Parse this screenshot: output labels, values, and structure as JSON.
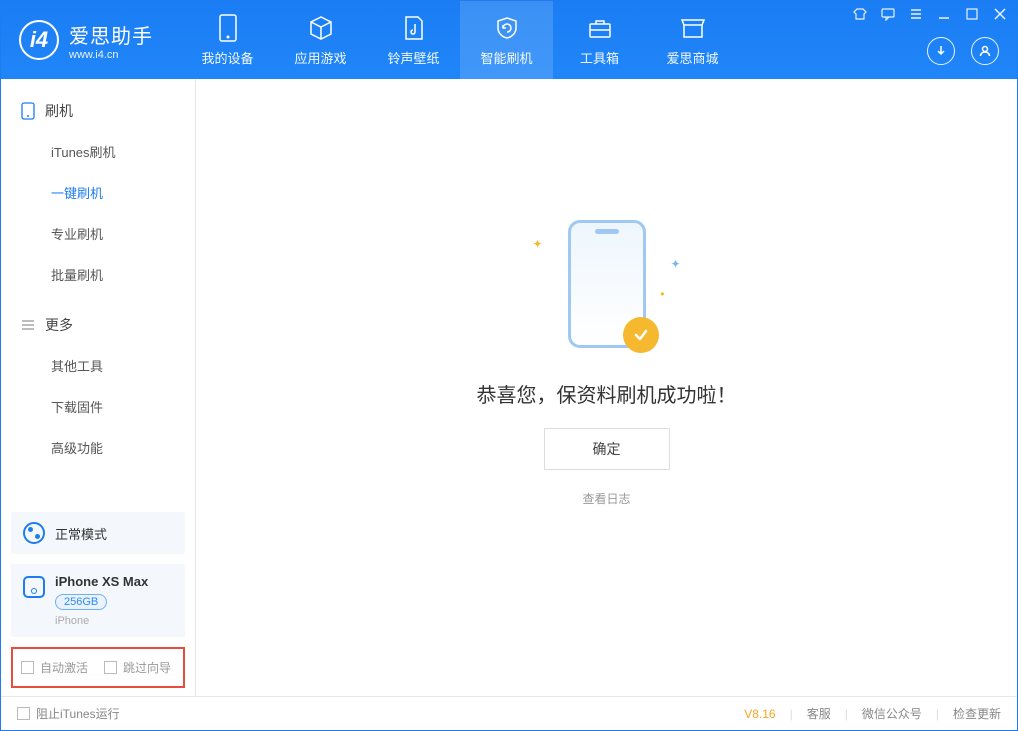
{
  "app": {
    "name_cn": "爱思助手",
    "name_en": "www.i4.cn"
  },
  "nav": {
    "tabs": [
      {
        "label": "我的设备"
      },
      {
        "label": "应用游戏"
      },
      {
        "label": "铃声壁纸"
      },
      {
        "label": "智能刷机"
      },
      {
        "label": "工具箱"
      },
      {
        "label": "爱思商城"
      }
    ],
    "active_index": 3
  },
  "sidebar": {
    "section1_title": "刷机",
    "section1_items": [
      {
        "label": "iTunes刷机"
      },
      {
        "label": "一键刷机"
      },
      {
        "label": "专业刷机"
      },
      {
        "label": "批量刷机"
      }
    ],
    "section1_active_index": 1,
    "section2_title": "更多",
    "section2_items": [
      {
        "label": "其他工具"
      },
      {
        "label": "下载固件"
      },
      {
        "label": "高级功能"
      }
    ]
  },
  "status": {
    "mode_label": "正常模式"
  },
  "device": {
    "name": "iPhone XS Max",
    "capacity": "256GB",
    "type": "iPhone"
  },
  "options": {
    "auto_activate": "自动激活",
    "skip_guide": "跳过向导"
  },
  "main": {
    "success_message": "恭喜您，保资料刷机成功啦！",
    "ok_button": "确定",
    "view_log": "查看日志"
  },
  "footer": {
    "block_itunes": "阻止iTunes运行",
    "version": "V8.16",
    "links": {
      "customer_service": "客服",
      "wechat": "微信公众号",
      "check_update": "检查更新"
    }
  }
}
